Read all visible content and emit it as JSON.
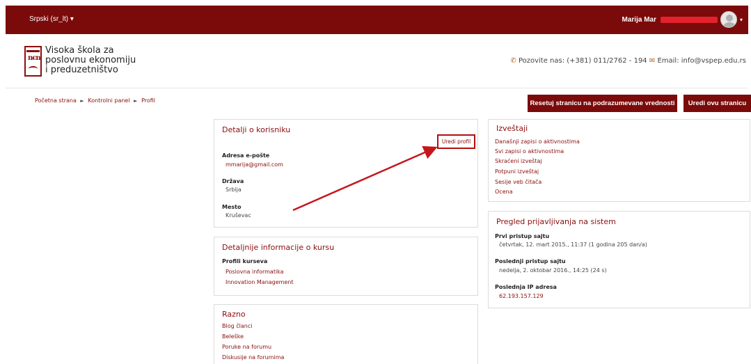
{
  "topbar": {
    "language": "Srpski (sr_lt) ▾",
    "user_name": "Marija Mar",
    "user_caret": "▾"
  },
  "logo": {
    "line1": "Visoka škola za",
    "line2": "poslovnu ekonomiju",
    "line3": "i preduzetništvo"
  },
  "contact": {
    "phone_icon": "phone-icon",
    "phone_text": "Pozovite nas: (+381) 011/2762 - 194",
    "mail_icon": "mail-icon",
    "mail_text": "Email: info@vspep.edu.rs"
  },
  "breadcrumb": {
    "items": [
      "Početna strana",
      "Kontrolni panel",
      "Profil"
    ],
    "separator": "►"
  },
  "buttons": {
    "reset": "Resetuj stranicu na podrazumevane vrednosti",
    "edit_page": "Uredi ovu stranicu"
  },
  "user_details": {
    "title": "Detalji o korisniku",
    "edit_profile": "Uredi profil",
    "email_label": "Adresa e-pošte",
    "email_value": "mmarija@gmail.com",
    "country_label": "Država",
    "country_value": "Srbija",
    "city_label": "Mesto",
    "city_value": "Kruševac"
  },
  "course_details": {
    "title": "Detaljnije informacije o kursu",
    "profiles_label": "Profili kurseva",
    "courses": [
      "Poslovna informatika",
      "Innovation Management"
    ]
  },
  "misc": {
    "title": "Razno",
    "links": [
      "Blog članci",
      "Beleške",
      "Poruke na forumu",
      "Diskusije na forumima"
    ]
  },
  "reports": {
    "title": "Izveštaji",
    "links": [
      "Današnji zapisi o aktivnostima",
      "Svi zapisi o aktivnostima",
      "Skraćeni izveštaj",
      "Potpuni izveštaj",
      "Sesije veb čitača",
      "Ocena"
    ]
  },
  "login": {
    "title": "Pregled prijavljivanja na sistem",
    "first_label": "Prvi pristup sajtu",
    "first_value": "četvrtak, 12. mart 2015., 11:37  (1 godina 205 dan/a)",
    "last_label": "Poslednji pristup sajtu",
    "last_value": "nedelja, 2. oktobar 2016., 14:25  (24 s)",
    "ip_label": "Poslednja IP adresa",
    "ip_value": "62.193.157.129"
  },
  "colors": {
    "brand": "#7b0a0a",
    "link": "#8b0d0d",
    "annotation": "#c4161c"
  }
}
